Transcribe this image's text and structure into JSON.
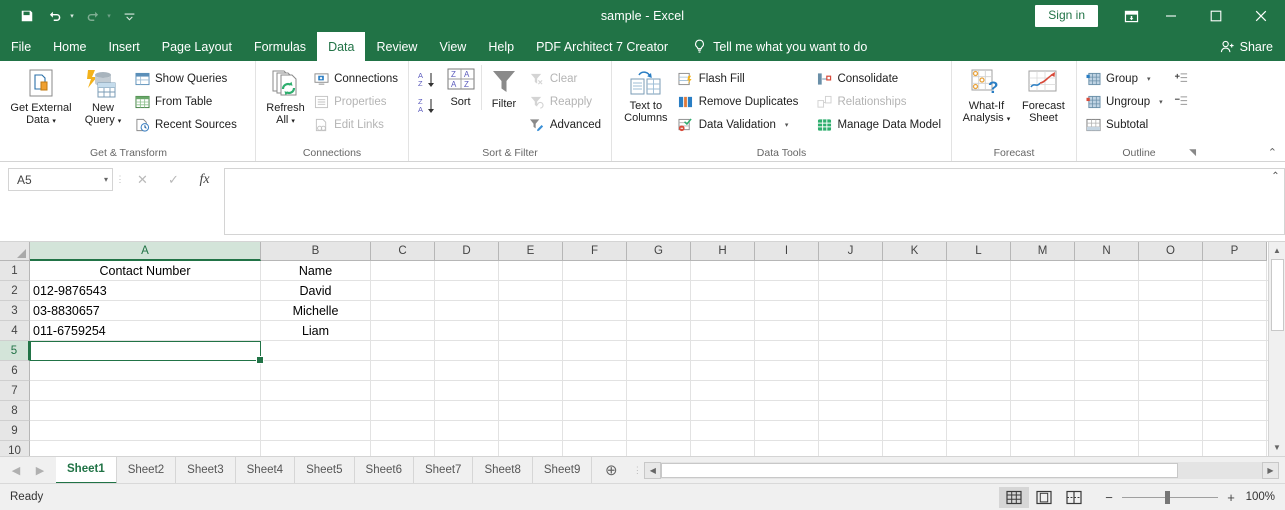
{
  "titlebar": {
    "title": "sample  -  Excel",
    "quick_access": [
      {
        "name": "save-icon",
        "label": "Save"
      },
      {
        "name": "undo-icon",
        "label": "Undo"
      },
      {
        "name": "redo-icon",
        "label": "Redo"
      },
      {
        "name": "customize-quick-access-icon",
        "label": "Customize Quick Access Toolbar"
      }
    ],
    "sign_in": "Sign in",
    "ribbon_display_options": "Ribbon Display Options",
    "minimize": "Minimize",
    "maximize": "Maximize",
    "close": "Close"
  },
  "tabs": [
    {
      "label": "File",
      "active": false
    },
    {
      "label": "Home",
      "active": false
    },
    {
      "label": "Insert",
      "active": false
    },
    {
      "label": "Page Layout",
      "active": false
    },
    {
      "label": "Formulas",
      "active": false
    },
    {
      "label": "Data",
      "active": true
    },
    {
      "label": "Review",
      "active": false
    },
    {
      "label": "View",
      "active": false
    },
    {
      "label": "Help",
      "active": false
    },
    {
      "label": "PDF Architect 7 Creator",
      "active": false
    }
  ],
  "tellme": "Tell me what you want to do",
  "share": "Share",
  "ribbon": {
    "groups": [
      {
        "label": "Get & Transform",
        "big": [
          {
            "label": "Get External\nData",
            "caret": true,
            "name": "get-external-data-button"
          }
        ],
        "big2": [
          {
            "label": "New\nQuery",
            "caret": true,
            "name": "new-query-button"
          }
        ],
        "small": [
          {
            "label": "Show Queries",
            "disabled": false,
            "name": "show-queries-button"
          },
          {
            "label": "From Table",
            "disabled": false,
            "name": "from-table-button"
          },
          {
            "label": "Recent Sources",
            "disabled": false,
            "name": "recent-sources-button"
          }
        ]
      },
      {
        "label": "Connections",
        "big": [
          {
            "label": "Refresh\nAll",
            "caret": true,
            "name": "refresh-all-button"
          }
        ],
        "small": [
          {
            "label": "Connections",
            "disabled": false,
            "name": "connections-button"
          },
          {
            "label": "Properties",
            "disabled": true,
            "name": "properties-button"
          },
          {
            "label": "Edit Links",
            "disabled": true,
            "name": "edit-links-button"
          }
        ]
      },
      {
        "label": "Sort & Filter",
        "sort_az": "Sort A to Z",
        "sort_za": "Sort Z to A",
        "big": [
          {
            "label": "Sort",
            "caret": false,
            "name": "sort-button"
          }
        ],
        "big2": [
          {
            "label": "Filter",
            "caret": false,
            "name": "filter-button"
          }
        ],
        "small": [
          {
            "label": "Clear",
            "disabled": true,
            "name": "clear-filter-button"
          },
          {
            "label": "Reapply",
            "disabled": true,
            "name": "reapply-button"
          },
          {
            "label": "Advanced",
            "disabled": false,
            "name": "advanced-filter-button"
          }
        ]
      },
      {
        "label": "Data Tools",
        "big": [
          {
            "label": "Text to\nColumns",
            "caret": false,
            "name": "text-to-columns-button"
          }
        ],
        "small": [
          {
            "label": "Flash Fill",
            "disabled": false,
            "name": "flash-fill-button"
          },
          {
            "label": "Remove Duplicates",
            "disabled": false,
            "name": "remove-duplicates-button"
          },
          {
            "label": "Data Validation",
            "disabled": false,
            "caret": true,
            "name": "data-validation-button"
          }
        ],
        "small2": [
          {
            "label": "Consolidate",
            "disabled": false,
            "name": "consolidate-button"
          },
          {
            "label": "Relationships",
            "disabled": true,
            "name": "relationships-button"
          },
          {
            "label": "Manage Data Model",
            "disabled": false,
            "name": "manage-data-model-button"
          }
        ]
      },
      {
        "label": "Forecast",
        "big": [
          {
            "label": "What-If\nAnalysis",
            "caret": true,
            "name": "what-if-analysis-button"
          }
        ],
        "big2": [
          {
            "label": "Forecast\nSheet",
            "caret": false,
            "name": "forecast-sheet-button"
          }
        ]
      },
      {
        "label": "Outline",
        "small": [
          {
            "label": "Group",
            "disabled": false,
            "caret": true,
            "name": "group-button"
          },
          {
            "label": "Ungroup",
            "disabled": false,
            "caret": true,
            "name": "ungroup-button"
          },
          {
            "label": "Subtotal",
            "disabled": false,
            "name": "subtotal-button"
          }
        ],
        "show_detail": "Show Detail",
        "hide_detail": "Hide Detail",
        "dialog_launcher": "Outline settings"
      }
    ],
    "collapse": "Collapse the Ribbon"
  },
  "formulabar": {
    "namebox_value": "A5",
    "cancel": "Cancel",
    "enter": "Enter",
    "insert_function": "fx",
    "formula_value": "",
    "expand": "Expand Formula Bar"
  },
  "grid": {
    "columns": [
      "A",
      "B",
      "C",
      "D",
      "E",
      "F",
      "G",
      "H",
      "I",
      "J",
      "K",
      "L",
      "M",
      "N",
      "O",
      "P"
    ],
    "rows": [
      "1",
      "2",
      "3",
      "4",
      "5",
      "6",
      "7",
      "8",
      "9",
      "10"
    ],
    "selected_cell": "A5",
    "selected_column": "A",
    "selected_row": "5",
    "data": [
      {
        "A": "Contact Number",
        "A_align": "c",
        "B": "Name",
        "B_align": "c"
      },
      {
        "A": "012-9876543",
        "A_align": "l",
        "B": "David",
        "B_align": "c"
      },
      {
        "A": "03-8830657",
        "A_align": "l",
        "B": "Michelle",
        "B_align": "c"
      },
      {
        "A": "011-6759254",
        "A_align": "l",
        "B": "Liam",
        "B_align": "c"
      },
      {
        "A": "",
        "A_align": "l",
        "B": "",
        "B_align": "c"
      },
      {
        "A": "",
        "A_align": "l",
        "B": "",
        "B_align": "c"
      },
      {
        "A": "",
        "A_align": "l",
        "B": "",
        "B_align": "c"
      },
      {
        "A": "",
        "A_align": "l",
        "B": "",
        "B_align": "c"
      },
      {
        "A": "",
        "A_align": "l",
        "B": "",
        "B_align": "c"
      },
      {
        "A": "",
        "A_align": "l",
        "B": "",
        "B_align": "c"
      }
    ]
  },
  "sheetbar": {
    "first_sheet": "First Sheet",
    "prev_sheet": "Previous Sheet",
    "sheets": [
      {
        "label": "Sheet1",
        "active": true
      },
      {
        "label": "Sheet2",
        "active": false
      },
      {
        "label": "Sheet3",
        "active": false
      },
      {
        "label": "Sheet4",
        "active": false
      },
      {
        "label": "Sheet5",
        "active": false
      },
      {
        "label": "Sheet6",
        "active": false
      },
      {
        "label": "Sheet7",
        "active": false
      },
      {
        "label": "Sheet8",
        "active": false
      },
      {
        "label": "Sheet9",
        "active": false
      }
    ],
    "add_sheet": "New sheet"
  },
  "statusbar": {
    "status": "Ready",
    "views": [
      {
        "name": "normal-view-icon",
        "label": "Normal",
        "active": true
      },
      {
        "name": "page-layout-view-icon",
        "label": "Page Layout",
        "active": false
      },
      {
        "name": "page-break-preview-icon",
        "label": "Page Break Preview",
        "active": false
      }
    ],
    "zoom_out": "−",
    "zoom_in": "+",
    "zoom_level": "100%"
  },
  "colors": {
    "brand_green": "#217346",
    "ribbon_bg": "#ffffff",
    "grid_header": "#e6e6e6",
    "selection": "#217346"
  }
}
